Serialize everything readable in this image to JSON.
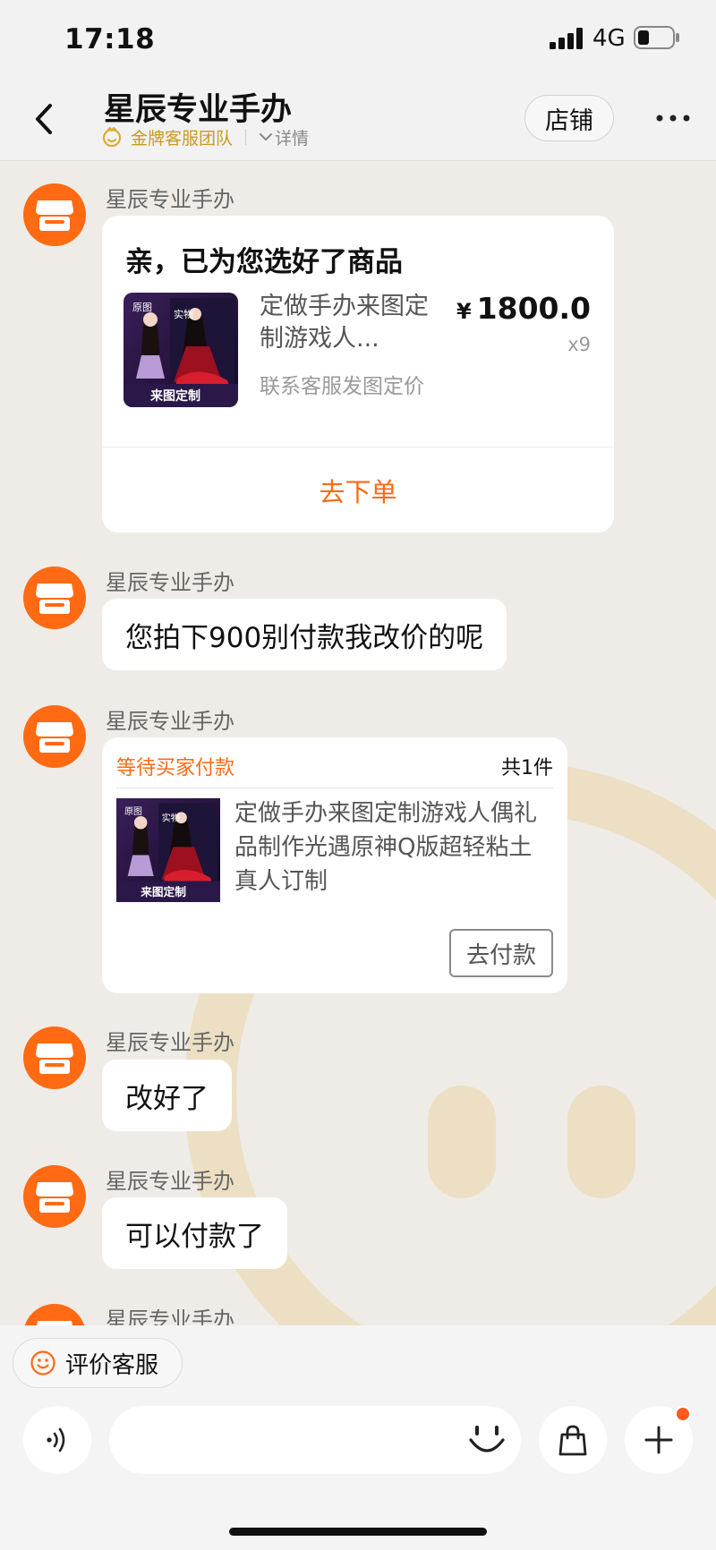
{
  "status_bar": {
    "time": "17:18",
    "network": "4G"
  },
  "header": {
    "shop_name": "星辰专业手办",
    "team_label": "金牌客服团队",
    "detail_label": "详情",
    "store_button": "店铺"
  },
  "messages": {
    "m1": {
      "sender": "星辰专业手办",
      "card_heading": "亲，已为您选好了商品",
      "product_name": "定做手办来图定制游戏人...",
      "product_note": "联系客服发图定价",
      "currency": "¥",
      "price": "1800.0",
      "quantity": "x9",
      "thumb_labels": {
        "top_left": "原图",
        "top_right": "实物",
        "bottom": "来图定制"
      },
      "action": "去下单"
    },
    "m2": {
      "sender": "星辰专业手办",
      "text": "您拍下900别付款我改价的呢"
    },
    "m3": {
      "sender": "星辰专业手办",
      "status": "等待买家付款",
      "count": "共1件",
      "product_name": "定做手办来图定制游戏人偶礼品制作光遇原神Q版超轻粘土真人订制",
      "thumb_labels": {
        "top_left": "原图",
        "top_right": "实物",
        "bottom": "来图定制"
      },
      "action": "去付款"
    },
    "m4": {
      "sender": "星辰专业手办",
      "text": "改好了"
    },
    "m5": {
      "sender": "星辰专业手办",
      "text": "可以付款了"
    },
    "m6": {
      "sender": "星辰专业手办"
    }
  },
  "bottom_bar": {
    "rate_label": "评价客服",
    "input_value": "",
    "icons": [
      "voice-icon",
      "emoji-icon",
      "shopping-bag-icon",
      "plus-icon"
    ]
  },
  "colors": {
    "accent": "#ff6a13",
    "gold": "#c99a1e",
    "background": "#efece7"
  }
}
